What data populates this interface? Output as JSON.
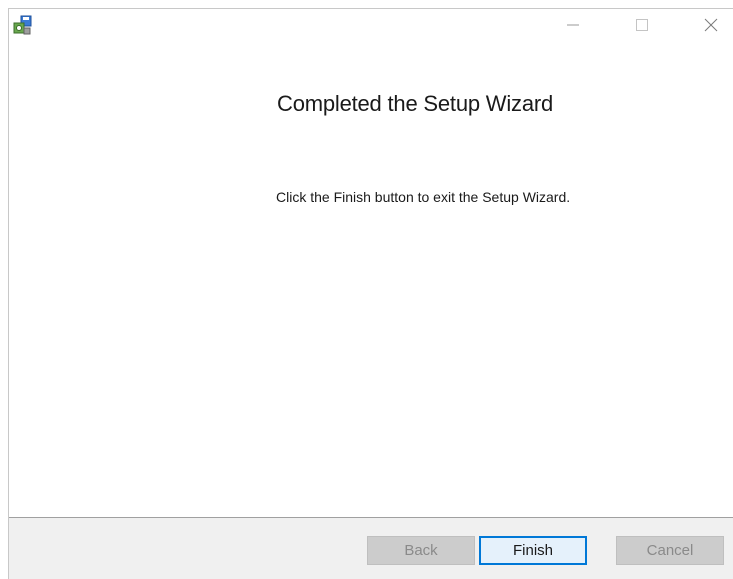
{
  "window": {
    "minimize_icon": "minimize-icon",
    "maximize_icon": "maximize-icon",
    "close_icon": "close-icon",
    "app_icon": "installer-icon"
  },
  "wizard": {
    "title": "Completed the Setup Wizard",
    "message": "Click the Finish button to exit the Setup Wizard."
  },
  "buttons": {
    "back": {
      "label": "Back",
      "enabled": false
    },
    "finish": {
      "label": "Finish",
      "enabled": true,
      "default": true
    },
    "cancel": {
      "label": "Cancel",
      "enabled": false
    }
  },
  "colors": {
    "accent": "#0078d7",
    "footer_bg": "#f0f0f0",
    "disabled_bg": "#cccccc"
  }
}
